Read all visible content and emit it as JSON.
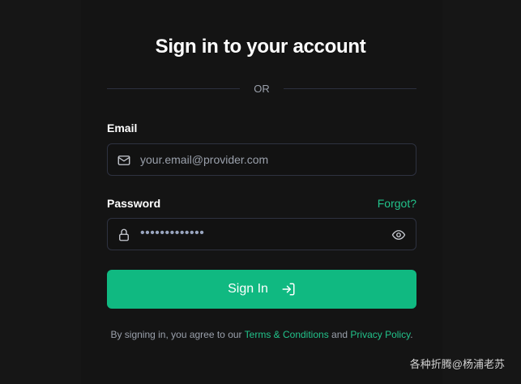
{
  "page": {
    "title": "Sign in to your account",
    "divider_text": "OR"
  },
  "email": {
    "label": "Email",
    "placeholder": "your.email@provider.com",
    "icon": "mail-icon"
  },
  "password": {
    "label": "Password",
    "forgot_link": "Forgot?",
    "masked_value": "•••••••••••••",
    "icon": "lock-icon",
    "toggle_icon": "eye-icon"
  },
  "signin_button": {
    "label": "Sign In",
    "icon": "sign-in-arrow-icon"
  },
  "legal": {
    "prefix": "By signing in, you agree to our ",
    "terms": "Terms & Conditions",
    "conjunction": " and ",
    "privacy": "Privacy Policy",
    "suffix": "."
  },
  "watermark": {
    "text": "各种折腾@杨浦老苏"
  },
  "colors": {
    "background": "#161616",
    "accent": "#10b981",
    "link": "#22c38b",
    "border": "#2e3240",
    "muted_text": "#9aa0ab"
  }
}
